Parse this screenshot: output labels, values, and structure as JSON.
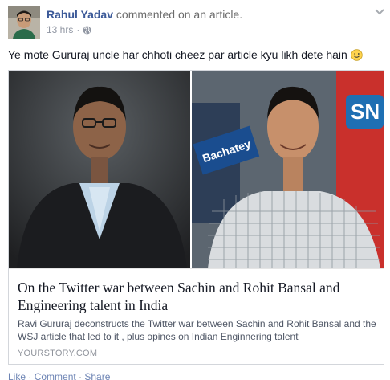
{
  "post": {
    "author": "Rahul Yadav",
    "action_text": "commented on an article.",
    "timestamp": "13 hrs",
    "separator": "·",
    "privacy_icon": "globe-icon",
    "menu_icon": "chevron-down-icon",
    "message": "Ye mote Gururaj uncle har chhoti cheez par article kyu likh dete hain",
    "emoji_icon": "smiley-icon"
  },
  "link_card": {
    "image_text": {
      "left_sign": "Bachatey",
      "right_sign": "SN"
    },
    "title": "On the Twitter war between Sachin and Rohit Bansal and Engineering talent in India",
    "description": "Ravi Gururaj deconstructs the Twitter war between Sachin and Rohit Bansal and the WSJ article that led to it , plus opines on Indian Enginnering talent",
    "source": "YOURSTORY.COM"
  },
  "actions": {
    "like": "Like",
    "comment": "Comment",
    "share": "Share",
    "dot": " · "
  },
  "colors": {
    "link_blue": "#3b5998",
    "meta_gray": "#9197a3",
    "border": "#d3d6db"
  }
}
